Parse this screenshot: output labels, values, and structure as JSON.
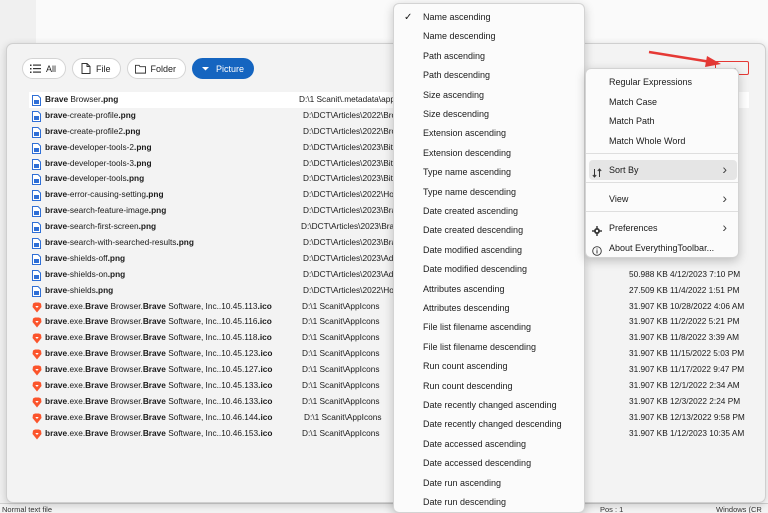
{
  "filters": [
    {
      "label": "All",
      "icon": "list-icon",
      "active": false
    },
    {
      "label": "File",
      "icon": "file-icon",
      "active": false
    },
    {
      "label": "Folder",
      "icon": "folder-icon",
      "active": false
    },
    {
      "label": "Picture",
      "icon": "chevron-down-icon",
      "active": true
    }
  ],
  "more_button": "...",
  "files": [
    {
      "pre": "",
      "bold": "Brave",
      "mid": " Browser",
      "ext": ".png",
      "path": "D:\\1 Scanit\\.metadata\\app",
      "size": "",
      "icon": "png",
      "selected": true
    },
    {
      "pre": "",
      "bold": "brave",
      "mid": "-create-profile",
      "ext": ".png",
      "path": "D:\\DCT\\Articles\\2022\\Brow",
      "size": "",
      "icon": "png"
    },
    {
      "pre": "",
      "bold": "brave",
      "mid": "-create-profile2",
      "ext": ".png",
      "path": "D:\\DCT\\Articles\\2022\\Brow",
      "size": "",
      "icon": "png"
    },
    {
      "pre": "",
      "bold": "brave",
      "mid": "-developer-tools-2",
      "ext": ".png",
      "path": "D:\\DCT\\Articles\\2023\\Bitwa",
      "size": "",
      "icon": "png"
    },
    {
      "pre": "",
      "bold": "brave",
      "mid": "-developer-tools-3",
      "ext": ".png",
      "path": "D:\\DCT\\Articles\\2023\\Bitwa",
      "size": "",
      "icon": "png"
    },
    {
      "pre": "",
      "bold": "brave",
      "mid": "-developer-tools",
      "ext": ".png",
      "path": "D:\\DCT\\Articles\\2023\\Bitwa",
      "size": "",
      "icon": "png"
    },
    {
      "pre": "",
      "bold": "brave",
      "mid": "-error-causing-setting",
      "ext": ".png",
      "path": "D:\\DCT\\Articles\\2022\\How",
      "size": "",
      "icon": "png"
    },
    {
      "pre": "",
      "bold": "brave",
      "mid": "-search-feature-image",
      "ext": ".png",
      "path": "D:\\DCT\\Articles\\2023\\Brave",
      "size": "",
      "icon": "png"
    },
    {
      "pre": "",
      "bold": "brave",
      "mid": "-search-first-screen",
      "ext": ".png",
      "path": "D:\\DCT\\Articles\\2023\\Brave",
      "size": "",
      "icon": "png"
    },
    {
      "pre": "",
      "bold": "brave",
      "mid": "-search-with-searched-results",
      "ext": ".png",
      "path": "D:\\DCT\\Articles\\2023\\Brave",
      "size": "",
      "icon": "png"
    },
    {
      "pre": "",
      "bold": "brave",
      "mid": "-shields-off",
      "ext": ".png",
      "path": "D:\\DCT\\Articles\\2023\\Adblo",
      "size": "",
      "icon": "png"
    },
    {
      "pre": "",
      "bold": "brave",
      "mid": "-shields-on",
      "ext": ".png",
      "path": "D:\\DCT\\Articles\\2023\\Adblo",
      "size": "50.988 KB 4/12/2023 7:10 PM",
      "icon": "png"
    },
    {
      "pre": "",
      "bold": "brave",
      "mid": "-shields",
      "ext": ".png",
      "path": "D:\\DCT\\Articles\\2022\\How",
      "size": "27.509 KB 11/4/2022 1:51 PM",
      "icon": "png"
    },
    {
      "pre": "",
      "bold": "brave",
      "mid": ".exe.",
      "ext": ".ico",
      "path": "D:\\1 Scanit\\AppIcons",
      "size": "31.907 KB 10/28/2022 4:06 AM",
      "icon": "brave",
      "tail": "1.45.113"
    },
    {
      "pre": "",
      "bold": "brave",
      "mid": ".exe.",
      "ext": ".ico",
      "path": "D:\\1 Scanit\\AppIcons",
      "size": "31.907 KB 11/2/2022 5:21 PM",
      "icon": "brave",
      "tail": "1.45.116"
    },
    {
      "pre": "",
      "bold": "brave",
      "mid": ".exe.",
      "ext": ".ico",
      "path": "D:\\1 Scanit\\AppIcons",
      "size": "31.907 KB 11/8/2022 3:39 AM",
      "icon": "brave",
      "tail": "1.45.118"
    },
    {
      "pre": "",
      "bold": "brave",
      "mid": ".exe.",
      "ext": ".ico",
      "path": "D:\\1 Scanit\\AppIcons",
      "size": "31.907 KB 11/15/2022 5:03 PM",
      "icon": "brave",
      "tail": "1.45.123"
    },
    {
      "pre": "",
      "bold": "brave",
      "mid": ".exe.",
      "ext": ".ico",
      "path": "D:\\1 Scanit\\AppIcons",
      "size": "31.907 KB 11/17/2022 9:47 PM",
      "icon": "brave",
      "tail": "1.45.127"
    },
    {
      "pre": "",
      "bold": "brave",
      "mid": ".exe.",
      "ext": ".ico",
      "path": "D:\\1 Scanit\\AppIcons",
      "size": "31.907 KB 12/1/2022 2:34 AM",
      "icon": "brave",
      "tail": "1.45.133"
    },
    {
      "pre": "",
      "bold": "brave",
      "mid": ".exe.",
      "ext": ".ico",
      "path": "D:\\1 Scanit\\AppIcons",
      "size": "31.907 KB 12/3/2022 2:24 PM",
      "icon": "brave",
      "tail": "1.46.133"
    },
    {
      "pre": "",
      "bold": "brave",
      "mid": ".exe.",
      "ext": ".ico",
      "path": "D:\\1 Scanit\\AppIcons",
      "size": "31.907 KB 12/13/2022 9:58 PM",
      "icon": "brave",
      "tail": "1.46.144"
    },
    {
      "pre": "",
      "bold": "brave",
      "mid": ".exe.",
      "ext": ".ico",
      "path": "D:\\1 Scanit\\AppIcons",
      "size": "31.907 KB 1/12/2023 10:35 AM",
      "icon": "brave",
      "tail": "1.46.153"
    }
  ],
  "ico_labels": {
    "a": "Brave",
    "b": " Browser.",
    "c": "Brave",
    "d": " Software, Inc..10"
  },
  "sort_menu": {
    "checked_index": 0,
    "items": [
      "Name ascending",
      "Name descending",
      "Path ascending",
      "Path descending",
      "Size ascending",
      "Size descending",
      "Extension ascending",
      "Extension descending",
      "Type name ascending",
      "Type name descending",
      "Date created ascending",
      "Date created descending",
      "Date modified ascending",
      "Date modified descending",
      "Attributes ascending",
      "Attributes descending",
      "File list filename ascending",
      "File list filename descending",
      "Run count ascending",
      "Run count descending",
      "Date recently changed ascending",
      "Date recently changed descending",
      "Date accessed ascending",
      "Date accessed descending",
      "Date run ascending",
      "Date run descending"
    ]
  },
  "options_menu": {
    "items": [
      {
        "label": "Regular Expressions",
        "icon": "",
        "submenu": false
      },
      {
        "label": "Match Case",
        "icon": "",
        "submenu": false
      },
      {
        "label": "Match Path",
        "icon": "",
        "submenu": false
      },
      {
        "label": "Match Whole Word",
        "icon": "",
        "submenu": false
      },
      {
        "label": "Sort By",
        "icon": "sort-icon",
        "submenu": true,
        "highlighted": true
      },
      {
        "label": "View",
        "icon": "",
        "submenu": true
      },
      {
        "label": "Preferences",
        "icon": "gear-icon",
        "submenu": true
      },
      {
        "label": "About EverythingToolbar...",
        "icon": "info-icon",
        "submenu": false
      }
    ]
  },
  "status_bar": {
    "left": "Normal text file",
    "mid": "Pos : 1",
    "right": "Windows (CR"
  },
  "colors": {
    "accent": "#1565c0",
    "highlight_border": "#e53935",
    "brave_orange": "#fb542b",
    "png_blue": "#2f6fd6"
  }
}
